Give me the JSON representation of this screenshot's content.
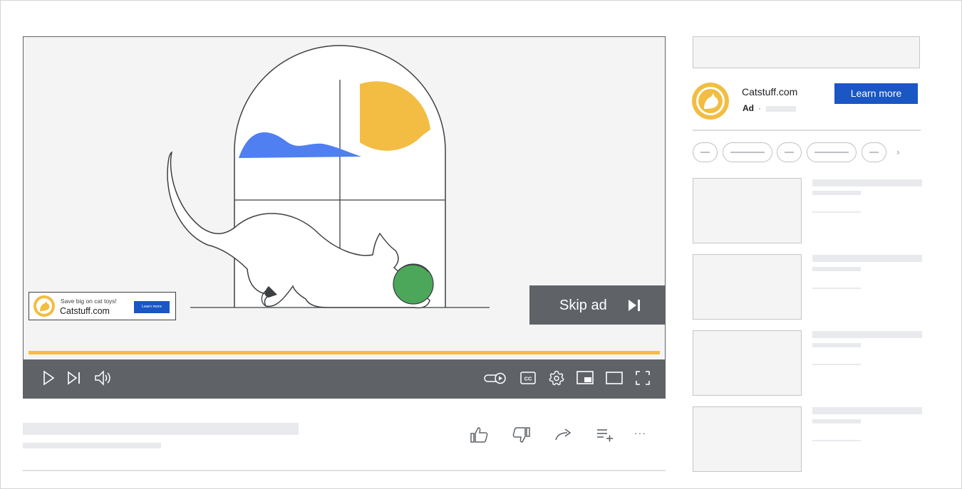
{
  "overlay_ad": {
    "tagline": "Save big on cat toys!",
    "site": "Catstuff.com",
    "button_label": "Learn more"
  },
  "skip_ad": {
    "label": "Skip ad"
  },
  "progress": {
    "fraction": 1.0
  },
  "sidebar_ad": {
    "site": "Catstuff.com",
    "ad_badge": "Ad",
    "separator": "·",
    "button_label": "Learn more"
  },
  "chips": {
    "more_chevron": "›"
  },
  "colors": {
    "accent_blue": "#1a56c4",
    "progress_yellow": "#f2bd42",
    "control_bar": "#5f6368",
    "sun_yellow": "#f2bd42",
    "sky_blue": "#4f7ff0",
    "ball_green": "#4ca75a"
  },
  "icons": {
    "player_controls": [
      "play-icon",
      "next-icon",
      "volume-icon",
      "autoplay-toggle-icon",
      "captions-icon",
      "settings-icon",
      "miniplayer-icon",
      "theater-mode-icon",
      "fullscreen-icon"
    ],
    "actions": [
      "like-icon",
      "dislike-icon",
      "share-icon",
      "save-to-playlist-icon",
      "more-options-icon"
    ]
  },
  "captions_icon_text": "CC",
  "more_options_glyph": "···"
}
